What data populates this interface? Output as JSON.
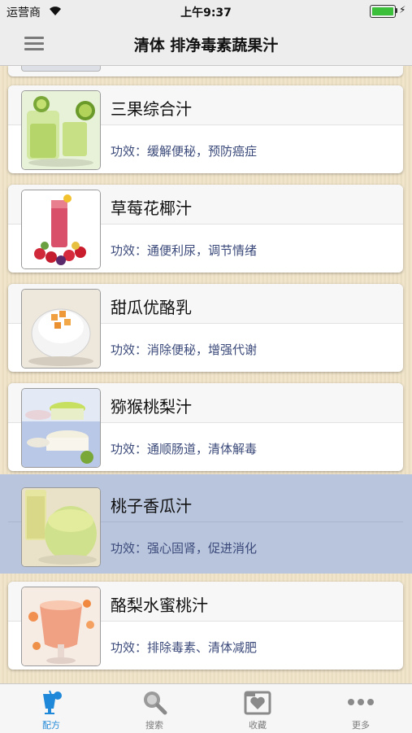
{
  "status_bar": {
    "carrier": "运营商",
    "time": "上午9:37",
    "battery_level": 1.0
  },
  "nav": {
    "title": "清体 排净毒素蔬果汁",
    "menu_icon": "hamburger-menu-icon"
  },
  "items": [
    {
      "name": "三果综合汁",
      "effect": "功效：缓解便秘，预防癌症",
      "selected": false
    },
    {
      "name": "草莓花椰汁",
      "effect": "功效：通便利尿，调节情绪",
      "selected": false
    },
    {
      "name": "甜瓜优酪乳",
      "effect": "功效：消除便秘，增强代谢",
      "selected": false
    },
    {
      "name": "猕猴桃梨汁",
      "effect": "功效：通顺肠道，清体解毒",
      "selected": false
    },
    {
      "name": "桃子香瓜汁",
      "effect": "功效：强心固肾，促进消化",
      "selected": true
    },
    {
      "name": "酪梨水蜜桃汁",
      "effect": "功效：排除毒素、清体减肥",
      "selected": false
    }
  ],
  "tabs": [
    {
      "label": "配方",
      "icon": "juice-glass-icon",
      "active": true
    },
    {
      "label": "搜索",
      "icon": "magnifier-icon",
      "active": false
    },
    {
      "label": "收藏",
      "icon": "heart-folder-icon",
      "active": false
    },
    {
      "label": "更多",
      "icon": "more-dots-icon",
      "active": false
    }
  ],
  "colors": {
    "selected_row": "#b9c5dd",
    "effect_text": "#3b4a7a",
    "tab_active": "#1f88d8",
    "background": "#efe2c6"
  }
}
